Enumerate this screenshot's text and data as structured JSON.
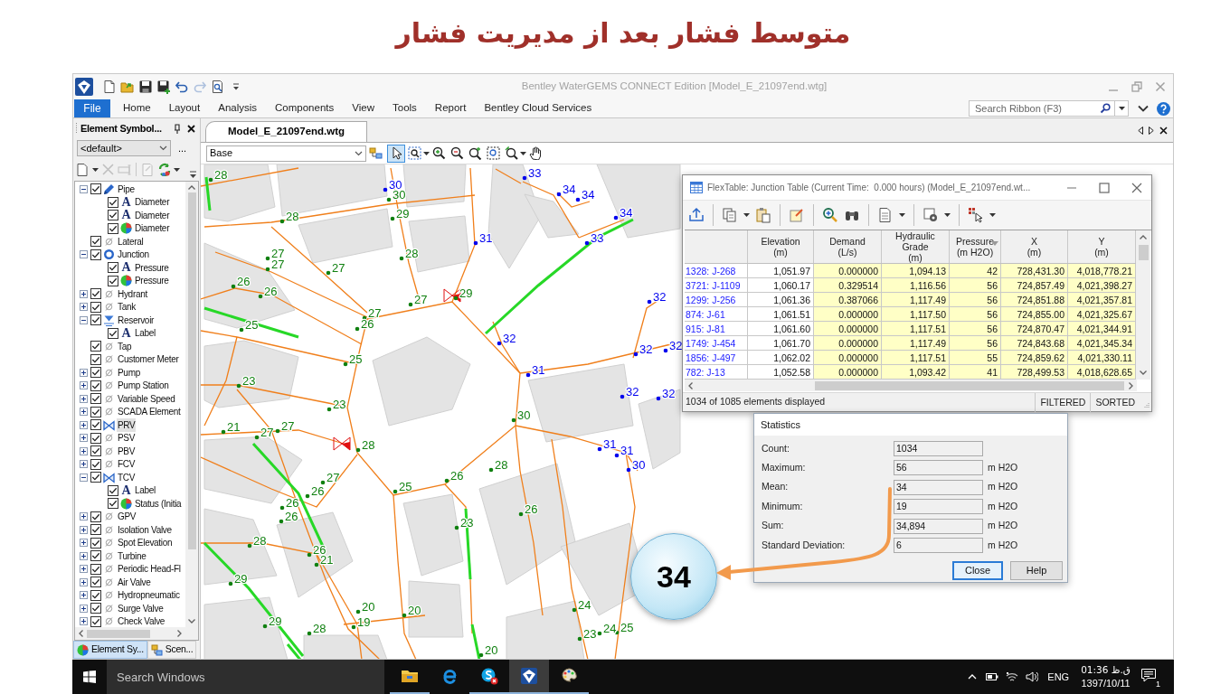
{
  "slide": {
    "title": "متوسط فشار بعد از مدیریت فشار"
  },
  "window": {
    "title": "Bentley WaterGEMS CONNECT Edition [Model_E_21097end.wtg]"
  },
  "quick_access": [
    {
      "disabled": false
    },
    {
      "disabled": false
    },
    {
      "disabled": false
    },
    {
      "disabled": false
    },
    {
      "disabled": false
    },
    {
      "disabled": true
    },
    {
      "disabled": false
    }
  ],
  "ribbon": {
    "tabs": [
      {
        "label": "File",
        "kind": "backstage"
      },
      {
        "label": "Home",
        "kind": "tab"
      },
      {
        "label": "Layout",
        "kind": "tab"
      },
      {
        "label": "Analysis",
        "kind": "tab"
      },
      {
        "label": "Components",
        "kind": "tab"
      },
      {
        "label": "View",
        "kind": "tab"
      },
      {
        "label": "Tools",
        "kind": "tab"
      },
      {
        "label": "Report",
        "kind": "tab"
      },
      {
        "label": "Bentley Cloud Services",
        "kind": "tab"
      }
    ],
    "search": {
      "placeholder": "Search Ribbon (F3)"
    }
  },
  "symbology_panel": {
    "title": "Element Symbol...",
    "profile": "<default>",
    "more": "...",
    "tools": [
      {
        "disabled": false
      },
      {
        "disabled": true
      },
      {
        "disabled": true
      },
      {
        "disabled": true
      },
      {
        "disabled": false
      }
    ],
    "items": [
      {
        "label": "Pipe",
        "kind": "pipe",
        "expanded": true,
        "checked": true,
        "selected": false,
        "children": [
          {
            "label": "Diameter",
            "kind": "annotation",
            "symbol": "A",
            "checked": true,
            "selected": false
          },
          {
            "label": "Diameter",
            "kind": "annotation",
            "symbol": "A",
            "checked": true,
            "selected": false
          },
          {
            "label": "Diameter",
            "kind": "color_coding",
            "checked": true,
            "selected": false
          }
        ]
      },
      {
        "label": "Lateral",
        "kind": "unstyled",
        "checked": true,
        "selected": false
      },
      {
        "label": "Junction",
        "kind": "junction",
        "expanded": true,
        "checked": true,
        "selected": false,
        "children": [
          {
            "label": "Pressure",
            "kind": "annotation",
            "symbol": "A",
            "checked": true,
            "selected": false
          },
          {
            "label": "Pressure",
            "kind": "color_coding",
            "checked": true,
            "selected": false
          }
        ]
      },
      {
        "label": "Hydrant",
        "kind": "unstyled",
        "expanded": false,
        "checked": true,
        "selected": false
      },
      {
        "label": "Tank",
        "kind": "unstyled",
        "expanded": false,
        "checked": true,
        "selected": false
      },
      {
        "label": "Reservoir",
        "kind": "reservoir",
        "expanded": true,
        "checked": true,
        "selected": false,
        "children": [
          {
            "label": "Label",
            "kind": "annotation",
            "symbol": "A",
            "checked": true,
            "selected": false
          }
        ]
      },
      {
        "label": "Tap",
        "kind": "unstyled",
        "checked": true,
        "selected": false
      },
      {
        "label": "Customer Meter",
        "kind": "unstyled",
        "checked": true,
        "selected": false
      },
      {
        "label": "Pump",
        "kind": "unstyled",
        "expanded": false,
        "checked": true,
        "selected": false
      },
      {
        "label": "Pump Station",
        "kind": "unstyled",
        "expanded": false,
        "checked": true,
        "selected": false
      },
      {
        "label": "Variable Speed",
        "kind": "unstyled",
        "expanded": false,
        "checked": true,
        "selected": false
      },
      {
        "label": "SCADA Element",
        "kind": "unstyled",
        "expanded": false,
        "checked": true,
        "selected": false
      },
      {
        "label": "PRV",
        "kind": "valve",
        "expanded": false,
        "checked": true,
        "selected": true
      },
      {
        "label": "PSV",
        "kind": "unstyled",
        "expanded": false,
        "checked": true,
        "selected": false
      },
      {
        "label": "PBV",
        "kind": "unstyled",
        "expanded": false,
        "checked": true,
        "selected": false
      },
      {
        "label": "FCV",
        "kind": "unstyled",
        "expanded": false,
        "checked": true,
        "selected": false
      },
      {
        "label": "TCV",
        "kind": "valve",
        "expanded": true,
        "checked": true,
        "selected": false,
        "children": [
          {
            "label": "Label",
            "kind": "annotation",
            "symbol": "A",
            "checked": true,
            "selected": false
          },
          {
            "label": "Status (Initia",
            "kind": "color_coding",
            "checked": true,
            "selected": false
          }
        ]
      },
      {
        "label": "GPV",
        "kind": "unstyled",
        "expanded": false,
        "checked": true,
        "selected": false
      },
      {
        "label": "Isolation Valve",
        "kind": "unstyled",
        "expanded": false,
        "checked": true,
        "selected": false
      },
      {
        "label": "Spot Elevation",
        "kind": "unstyled",
        "expanded": false,
        "checked": true,
        "selected": false
      },
      {
        "label": "Turbine",
        "kind": "unstyled",
        "expanded": false,
        "checked": true,
        "selected": false
      },
      {
        "label": "Periodic Head-Fl",
        "kind": "unstyled",
        "expanded": false,
        "checked": true,
        "selected": false
      },
      {
        "label": "Air Valve",
        "kind": "unstyled",
        "expanded": false,
        "checked": true,
        "selected": false
      },
      {
        "label": "Hydropneumatic",
        "kind": "unstyled",
        "expanded": false,
        "checked": true,
        "selected": false
      },
      {
        "label": "Surge Valve",
        "kind": "unstyled",
        "expanded": false,
        "checked": true,
        "selected": false
      },
      {
        "label": "Check Valve",
        "kind": "unstyled",
        "expanded": false,
        "checked": true,
        "selected": false
      }
    ],
    "tabs": [
      {
        "label": "Element Sy...",
        "selected": true
      },
      {
        "label": "Scen...",
        "selected": false
      }
    ]
  },
  "document_tab": {
    "label": "Model_E_21097end.wtg"
  },
  "map_toolbar": {
    "scenario": "Base",
    "tools": [
      {
        "selected": false
      },
      {
        "selected": true
      },
      {
        "selected": false
      },
      {
        "selected": false
      },
      {
        "selected": false
      },
      {
        "selected": false
      },
      {
        "selected": false
      },
      {
        "selected": false
      },
      {
        "selected": false
      }
    ]
  },
  "map": {
    "labels": [
      {
        "text": "28",
        "color": "#108010"
      },
      {
        "text": "33",
        "color": "#0000ee"
      },
      {
        "text": "30",
        "color": "#0000ee"
      },
      {
        "text": "30",
        "color": "#108010"
      },
      {
        "text": "34",
        "color": "#0000ee"
      },
      {
        "text": "34",
        "color": "#0000ee"
      },
      {
        "text": "28",
        "color": "#108010"
      },
      {
        "text": "29",
        "color": "#108010"
      },
      {
        "text": "34",
        "color": "#0000ee"
      },
      {
        "text": "31",
        "color": "#0000ee"
      },
      {
        "text": "33",
        "color": "#0000ee"
      },
      {
        "text": "27",
        "color": "#108010"
      },
      {
        "text": "28",
        "color": "#108010"
      },
      {
        "text": "27",
        "color": "#108010"
      },
      {
        "text": "27",
        "color": "#108010"
      },
      {
        "text": "26",
        "color": "#108010"
      },
      {
        "text": "26",
        "color": "#108010"
      },
      {
        "text": "27",
        "color": "#108010"
      },
      {
        "text": "29",
        "color": "#108010"
      },
      {
        "text": "32",
        "color": "#0000ee"
      },
      {
        "text": "27",
        "color": "#108010"
      },
      {
        "text": "25",
        "color": "#108010"
      },
      {
        "text": "26",
        "color": "#108010"
      },
      {
        "text": "32",
        "color": "#0000ee"
      },
      {
        "text": "32",
        "color": "#0000ee"
      },
      {
        "text": "32",
        "color": "#0000ee"
      },
      {
        "text": "25",
        "color": "#108010"
      },
      {
        "text": "31",
        "color": "#0000ee"
      },
      {
        "text": "23",
        "color": "#108010"
      },
      {
        "text": "32",
        "color": "#0000ee"
      },
      {
        "text": "32",
        "color": "#0000ee"
      },
      {
        "text": "23",
        "color": "#108010"
      },
      {
        "text": "30",
        "color": "#108010"
      },
      {
        "text": "21",
        "color": "#108010"
      },
      {
        "text": "27",
        "color": "#108010"
      },
      {
        "text": "27",
        "color": "#108010"
      },
      {
        "text": "28",
        "color": "#108010"
      },
      {
        "text": "31",
        "color": "#0000ee"
      },
      {
        "text": "31",
        "color": "#0000ee"
      },
      {
        "text": "28",
        "color": "#108010"
      },
      {
        "text": "30",
        "color": "#0000ee"
      },
      {
        "text": "27",
        "color": "#108010"
      },
      {
        "text": "26",
        "color": "#108010"
      },
      {
        "text": "26",
        "color": "#108010"
      },
      {
        "text": "25",
        "color": "#108010"
      },
      {
        "text": "26",
        "color": "#108010"
      },
      {
        "text": "26",
        "color": "#108010"
      },
      {
        "text": "26",
        "color": "#108010"
      },
      {
        "text": "23",
        "color": "#108010"
      },
      {
        "text": "28",
        "color": "#108010"
      },
      {
        "text": "26",
        "color": "#108010"
      },
      {
        "text": "21",
        "color": "#108010"
      },
      {
        "text": "29",
        "color": "#108010"
      },
      {
        "text": "20",
        "color": "#108010"
      },
      {
        "text": "20",
        "color": "#108010"
      },
      {
        "text": "24",
        "color": "#108010"
      },
      {
        "text": "29",
        "color": "#108010"
      },
      {
        "text": "28",
        "color": "#108010"
      },
      {
        "text": "19",
        "color": "#108010"
      },
      {
        "text": "23",
        "color": "#108010"
      },
      {
        "text": "24",
        "color": "#108010"
      },
      {
        "text": "25",
        "color": "#108010"
      },
      {
        "text": "20",
        "color": "#108010"
      }
    ]
  },
  "flex_table": {
    "title": "FlexTable: Junction Table (Current Time:  0.000 hours) (Model_E_21097end.wt...",
    "columns": [
      {
        "lines": [
          "Elevation",
          "(m)"
        ],
        "read_only": false,
        "sorted": false
      },
      {
        "lines": [
          "Demand",
          "(L/s)"
        ],
        "read_only": true,
        "sorted": false
      },
      {
        "lines": [
          "Hydraulic",
          "Grade",
          "(m)"
        ],
        "read_only": true,
        "sorted": false
      },
      {
        "lines": [
          "Pressure",
          "(m H2O)"
        ],
        "read_only": true,
        "sorted": true
      },
      {
        "lines": [
          "X",
          "(m)"
        ],
        "read_only": true,
        "sorted": false
      },
      {
        "lines": [
          "Y",
          "(m)"
        ],
        "read_only": true,
        "sorted": false
      }
    ],
    "rows": [
      {
        "label": "1328: J-268",
        "cells": [
          "1,051.97",
          "0.000000",
          "1,094.13",
          "42",
          "728,431.30",
          "4,018,778.21"
        ]
      },
      {
        "label": "3721: J-1109",
        "cells": [
          "1,060.17",
          "0.329514",
          "1,116.56",
          "56",
          "724,857.49",
          "4,021,398.27"
        ]
      },
      {
        "label": "1299: J-256",
        "cells": [
          "1,061.36",
          "0.387066",
          "1,117.49",
          "56",
          "724,851.88",
          "4,021,357.81"
        ]
      },
      {
        "label": "874: J-61",
        "cells": [
          "1,061.51",
          "0.000000",
          "1,117.50",
          "56",
          "724,855.00",
          "4,021,325.67"
        ]
      },
      {
        "label": "915: J-81",
        "cells": [
          "1,061.60",
          "0.000000",
          "1,117.51",
          "56",
          "724,870.47",
          "4,021,344.91"
        ]
      },
      {
        "label": "1749: J-454",
        "cells": [
          "1,061.70",
          "0.000000",
          "1,117.49",
          "56",
          "724,843.68",
          "4,021,345.34"
        ]
      },
      {
        "label": "1856: J-497",
        "cells": [
          "1,062.02",
          "0.000000",
          "1,117.51",
          "55",
          "724,859.62",
          "4,021,330.11"
        ]
      },
      {
        "label": "782: J-13",
        "cells": [
          "1,052.58",
          "0.000000",
          "1,093.42",
          "41",
          "728,499.53",
          "4,018,628.65"
        ]
      }
    ],
    "status": "1034 of 1085 elements displayed",
    "flags": [
      "FILTERED",
      "SORTED"
    ]
  },
  "statistics": {
    "title": "Statistics",
    "rows": [
      {
        "label": "Count:",
        "value": "1034"
      },
      {
        "label": "Maximum:",
        "value": "56",
        "unit": "m H2O"
      },
      {
        "label": "Mean:",
        "value": "34",
        "unit": "m H2O"
      },
      {
        "label": "Minimum:",
        "value": "19",
        "unit": "m H2O"
      },
      {
        "label": "Sum:",
        "value": "34,894",
        "unit": "m H2O"
      },
      {
        "label": "Standard Deviation:",
        "value": "6",
        "unit": "m H2O"
      }
    ],
    "buttons": [
      {
        "label": "Close",
        "default": true
      },
      {
        "label": "Help",
        "default": false
      }
    ]
  },
  "callout": {
    "text": "34"
  },
  "taskbar": {
    "search": {
      "placeholder": "Search Windows"
    },
    "apps": [
      {
        "running": true,
        "active": false
      },
      {
        "running": false,
        "active": false
      },
      {
        "running": true,
        "active": false
      },
      {
        "running": true,
        "active": true
      },
      {
        "running": true,
        "active": false
      }
    ],
    "language": "ENG",
    "time": "01:36 ق.ظ",
    "date": "1397/10/11",
    "notifications": "1"
  }
}
